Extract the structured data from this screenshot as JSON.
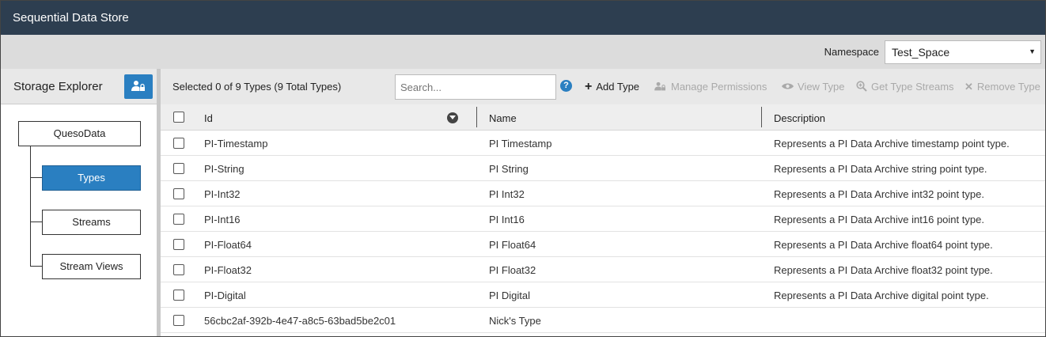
{
  "app": {
    "title": "Sequential Data Store"
  },
  "namespace": {
    "label": "Namespace",
    "value": "Test_Space",
    "arrow": "▼"
  },
  "explorer": {
    "title": "Storage Explorer",
    "tree": {
      "root": "QuesoData",
      "children": [
        "Types",
        "Streams",
        "Stream Views"
      ],
      "selected": "Types"
    }
  },
  "toolbar": {
    "selection": "Selected 0 of 9 Types (9 Total Types)",
    "search_placeholder": "Search...",
    "help": "?",
    "actions": [
      {
        "label": "Add Type",
        "icon": "plus-icon",
        "enabled": true
      },
      {
        "label": "Manage Permissions",
        "icon": "users-lock-icon",
        "enabled": false
      },
      {
        "label": "View Type",
        "icon": "eye-icon",
        "enabled": false
      },
      {
        "label": "Get Type Streams",
        "icon": "search-plus-icon",
        "enabled": false
      },
      {
        "label": "Remove Type",
        "icon": "close-icon",
        "enabled": false
      }
    ]
  },
  "grid": {
    "columns": [
      "Id",
      "Name",
      "Description"
    ],
    "rows": [
      {
        "id": "PI-Timestamp",
        "name": "PI Timestamp",
        "description": "Represents a PI Data Archive timestamp point type."
      },
      {
        "id": "PI-String",
        "name": "PI String",
        "description": "Represents a PI Data Archive string point type."
      },
      {
        "id": "PI-Int32",
        "name": "PI Int32",
        "description": "Represents a PI Data Archive int32 point type."
      },
      {
        "id": "PI-Int16",
        "name": "PI Int16",
        "description": "Represents a PI Data Archive int16 point type."
      },
      {
        "id": "PI-Float64",
        "name": "PI Float64",
        "description": "Represents a PI Data Archive float64 point type."
      },
      {
        "id": "PI-Float32",
        "name": "PI Float32",
        "description": "Represents a PI Data Archive float32 point type."
      },
      {
        "id": "PI-Digital",
        "name": "PI Digital",
        "description": "Represents a PI Data Archive digital point type."
      },
      {
        "id": "56cbc2af-392b-4e47-a8c5-63bad5be2c01",
        "name": "Nick's Type",
        "description": ""
      }
    ]
  },
  "colors": {
    "header": "#2d3e50",
    "accent": "#2a7fc1"
  }
}
